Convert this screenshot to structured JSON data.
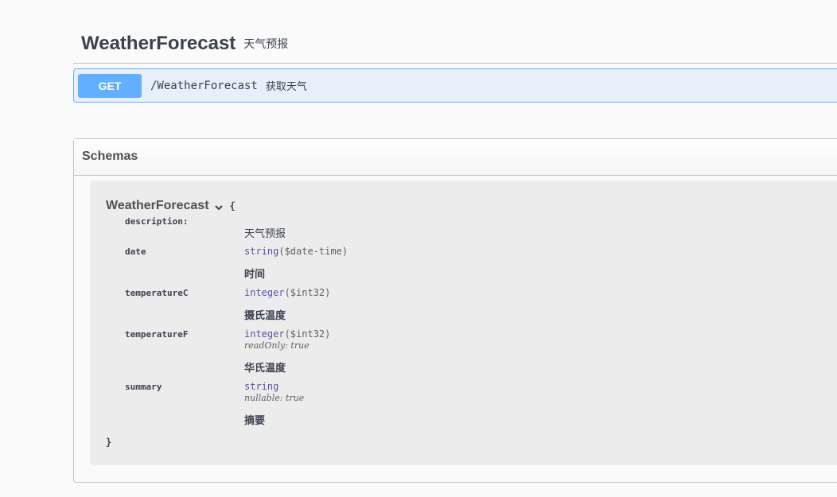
{
  "tag": {
    "name": "WeatherForecast",
    "description": "天气预报"
  },
  "operation": {
    "method": "GET",
    "path": "/WeatherForecast",
    "summary": "获取天气"
  },
  "schemas": {
    "title": "Schemas",
    "model": {
      "name": "WeatherForecast",
      "open_brace": "{",
      "close_brace": "}",
      "description_key": "description:",
      "description_value": "天气预报",
      "properties": [
        {
          "name": "date",
          "type": "string",
          "format": "($date-time)",
          "extra": "",
          "description": "时间"
        },
        {
          "name": "temperatureC",
          "type": "integer",
          "format": "($int32)",
          "extra": "",
          "description": "摄氏温度"
        },
        {
          "name": "temperatureF",
          "type": "integer",
          "format": "($int32)",
          "extra": "readOnly: true",
          "description": "华氏温度"
        },
        {
          "name": "summary",
          "type": "string",
          "format": "",
          "extra": "nullable: true",
          "description": "摘要"
        }
      ]
    }
  },
  "colors": {
    "get_accent": "#61affe",
    "type_color": "#55a"
  },
  "icons": {
    "model_toggle": "chevron-down-icon"
  }
}
